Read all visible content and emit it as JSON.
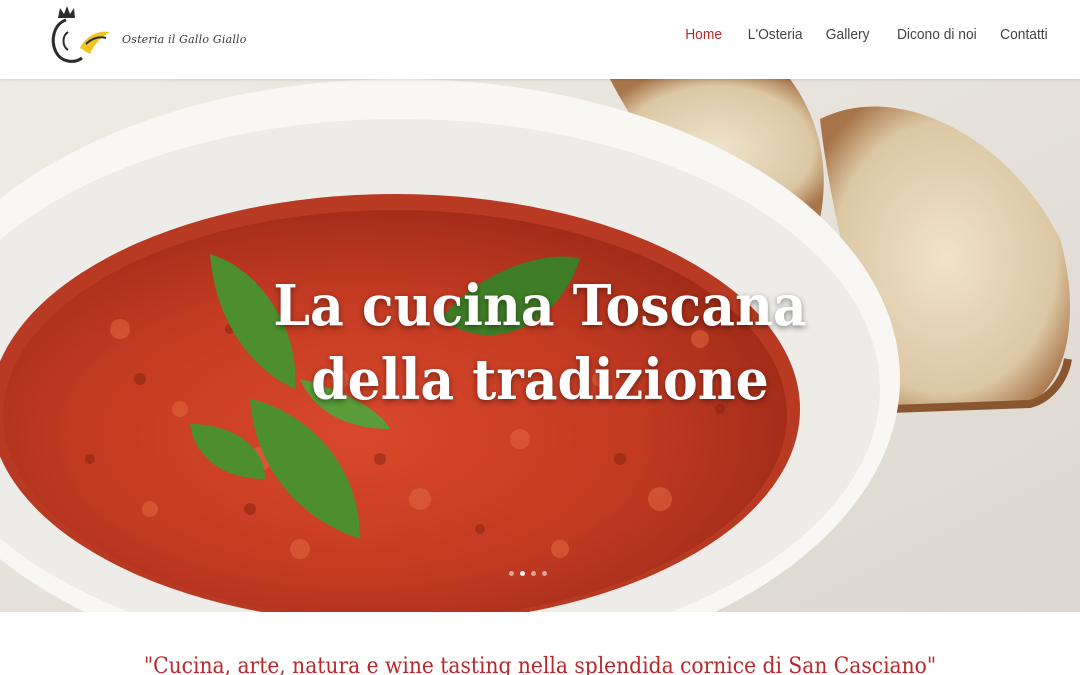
{
  "brand": {
    "name": "Osteria il Gallo Giallo",
    "logo_icon": "rooster-icon",
    "accent_color": "#b8282a"
  },
  "nav": {
    "items": [
      {
        "label": "Home",
        "active": true
      },
      {
        "label": "L'Osteria",
        "active": false
      },
      {
        "label": "Gallery",
        "active": false
      },
      {
        "label": "Dicono di noi",
        "active": false
      },
      {
        "label": "Contatti",
        "active": false
      }
    ]
  },
  "hero": {
    "title_line1": "La cucina Toscana",
    "title_line2": "della tradizione",
    "image": "bowl of pappa al pomodoro with basil and bread",
    "slides_count": 4,
    "active_slide": 2
  },
  "tagline": "\"Cucina, arte, natura e wine tasting nella splendida cornice di San Casciano\""
}
